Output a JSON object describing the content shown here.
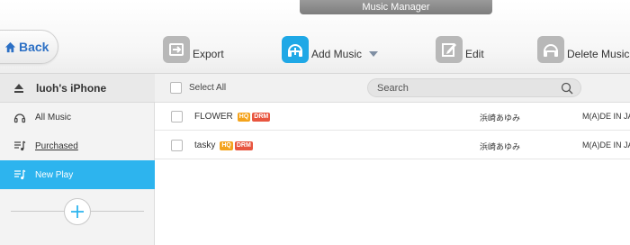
{
  "window": {
    "title": "Music Manager"
  },
  "toolbar": {
    "back_label": "Back",
    "export_label": "Export",
    "add_music_label": "Add Music",
    "edit_label": "Edit",
    "delete_label": "Delete Music"
  },
  "sidebar": {
    "device_name": "luoh's iPhone",
    "items": [
      {
        "label": "All Music",
        "icon": "headphones-icon",
        "active": false
      },
      {
        "label": "Purchased",
        "icon": "playlist-icon",
        "active": false
      },
      {
        "label": "New Play",
        "icon": "playlist-icon",
        "active": true
      }
    ]
  },
  "list": {
    "select_all_label": "Select All",
    "search_placeholder": "Search",
    "rows": [
      {
        "title": "FLOWER",
        "hq": "HQ",
        "drm": "DRM",
        "artist": "浜崎あゆみ",
        "album": "M(A)DE IN JA"
      },
      {
        "title": "tasky",
        "hq": "HQ",
        "drm": "DRM",
        "artist": "浜崎あゆみ",
        "album": "M(A)DE IN JA"
      }
    ]
  },
  "colors": {
    "accent": "#2db4ee",
    "back_text": "#2c70c5",
    "hq_badge": "#f4a31c",
    "drm_badge": "#e8553f"
  }
}
